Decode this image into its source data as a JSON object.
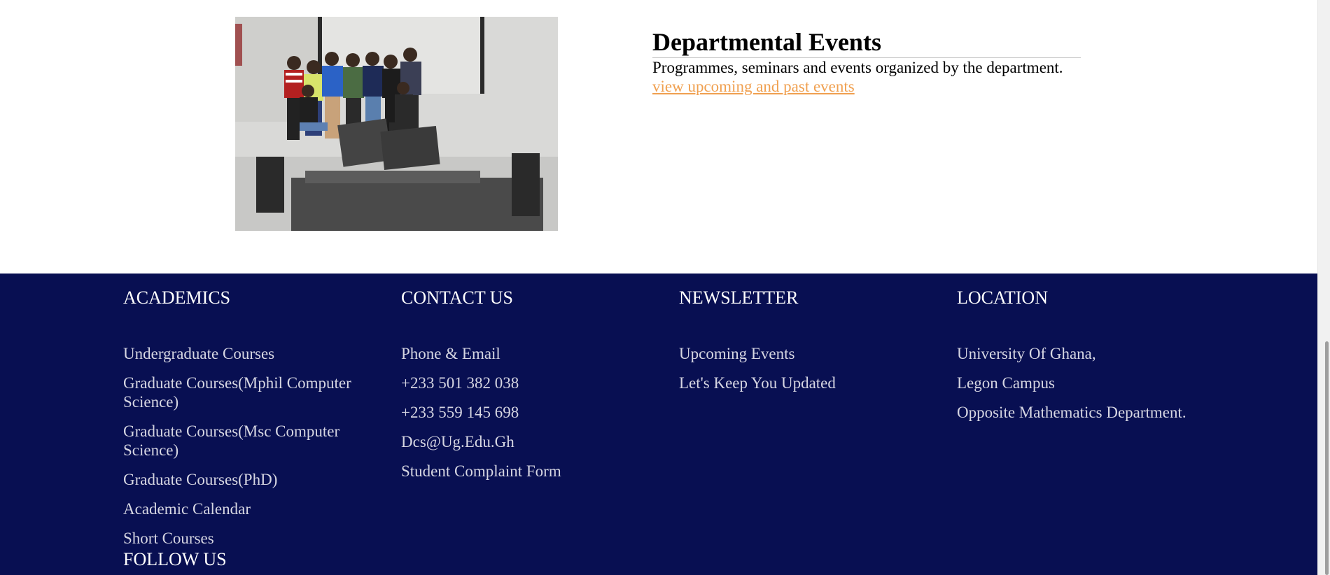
{
  "events": {
    "title": "Departmental Events",
    "description": "Programmes, seminars and events organized by the department.",
    "link_label": "view upcoming and past events",
    "link_color": "#f0a050"
  },
  "footer": {
    "background": "#080f52",
    "academics": {
      "title": "ACADEMICS",
      "items": [
        "Undergraduate Courses",
        "Graduate Courses(Mphil Computer Science)",
        "Graduate Courses(Msc Computer Science)",
        "Graduate Courses(PhD)",
        "Academic Calendar",
        "Short Courses"
      ]
    },
    "contact": {
      "title": "CONTACT US",
      "items": [
        "Phone & Email",
        "+233 501 382 038",
        "+233 559 145 698",
        "Dcs@Ug.Edu.Gh",
        "Student Complaint Form"
      ]
    },
    "newsletter": {
      "title": "NEWSLETTER",
      "items": [
        "Upcoming Events",
        "Let's Keep You Updated"
      ]
    },
    "location": {
      "title": "LOCATION",
      "items": [
        "University Of Ghana,",
        "Legon Campus",
        "Opposite Mathematics Department."
      ]
    },
    "follow_title": "FOLLOW US"
  }
}
